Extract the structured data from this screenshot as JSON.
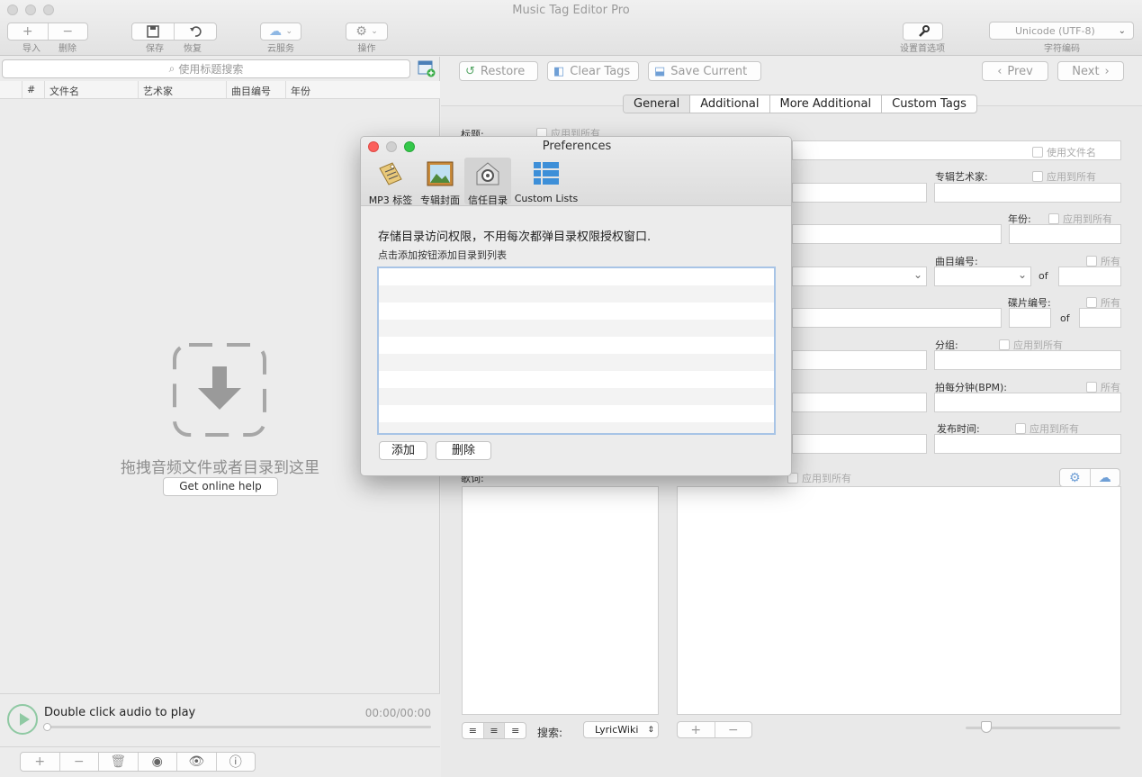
{
  "window": {
    "title": "Music Tag Editor Pro"
  },
  "toolbar": {
    "import_label": "导入",
    "delete_label": "删除",
    "save_label": "保存",
    "restore_label": "恢复",
    "cloud_label": "云服务",
    "action_label": "操作",
    "settings_label": "设置首选项",
    "encoding_value": "Unicode (UTF-8)",
    "encoding_label": "字符编码"
  },
  "file_list": {
    "search_placeholder": "使用标题搜索",
    "columns": [
      "#",
      "文件名",
      "艺术家",
      "曲目编号",
      "年份"
    ],
    "drop_text": "拖拽音频文件或者目录到这里",
    "help_button": "Get online help"
  },
  "player": {
    "label": "Double click audio to play",
    "time": "00:00/00:00"
  },
  "editor": {
    "restore": "Restore",
    "clear_tags": "Clear Tags",
    "save_current": "Save Current",
    "prev": "Prev",
    "next": "Next",
    "tabs": [
      "General",
      "Additional",
      "More Additional",
      "Custom Tags"
    ],
    "fields": {
      "title_label": "标题:",
      "apply_all": "应用到所有",
      "use_filename": "使用文件名",
      "album_artist": "专辑艺术家:",
      "year": "年份:",
      "track_no": "曲目编号:",
      "all": "所有",
      "of": "of",
      "disc_no": "碟片编号:",
      "grouping": "分组:",
      "bpm": "拍每分钟(BPM):",
      "release_time": "发布时间:",
      "lyrics": "歌词:"
    },
    "search_label": "搜索:",
    "lyric_source": "LyricWiki"
  },
  "preferences": {
    "title": "Preferences",
    "tabs": [
      {
        "label": "MP3 标签",
        "icon": "mp3-tag-icon"
      },
      {
        "label": "专辑封面",
        "icon": "album-cover-icon"
      },
      {
        "label": "信任目录",
        "icon": "trusted-folder-icon"
      },
      {
        "label": "Custom Lists",
        "icon": "custom-lists-icon"
      }
    ],
    "selected_tab": "信任目录",
    "description": "存储目录访问权限，不用每次都弹目录权限授权窗口.",
    "hint": "点击添加按钮添加目录到列表",
    "add_button": "添加",
    "delete_button": "删除"
  },
  "colors": {
    "close": "#fc605c",
    "minimize": "#d0d0d0",
    "zoom": "#34c84a",
    "play": "#8fc9a3",
    "list_focus": "#a8c4e6"
  }
}
